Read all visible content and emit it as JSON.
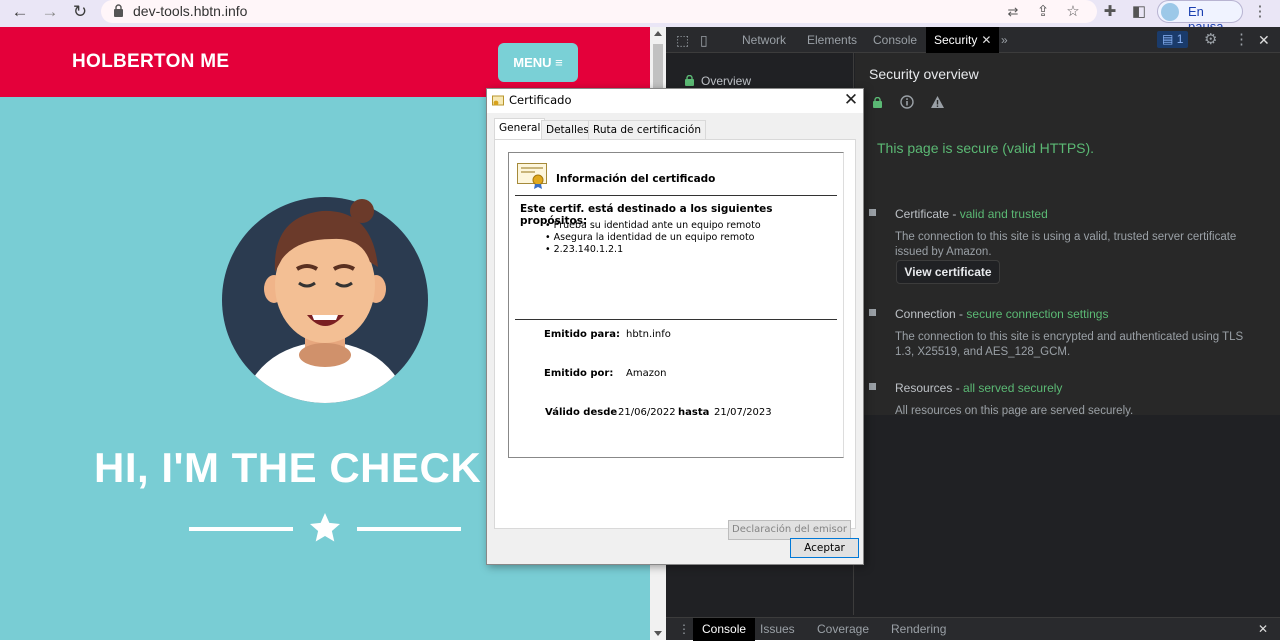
{
  "browser": {
    "url": "dev-tools.hbtn.info",
    "profile_label": "En pausa",
    "icons": [
      "back-icon",
      "forward-icon",
      "reload-icon",
      "lock-icon",
      "translate-icon",
      "share-icon",
      "star-icon",
      "extensions-icon",
      "sidepanel-icon",
      "more-icon"
    ]
  },
  "site": {
    "brand": "HOLBERTON ME",
    "menu_label": "MENU ≡",
    "hero_title": "HI, I'M THE CHECK",
    "colors": {
      "header": "#e4003a",
      "background": "#79cdd4"
    }
  },
  "devtools": {
    "tabs": [
      "Network",
      "Elements",
      "Console",
      "Security"
    ],
    "active_tab": "Security",
    "issues_count": "1",
    "sidebar": {
      "overview": "Overview"
    },
    "main": {
      "title": "Security overview",
      "secure_message": "This page is secure (valid HTTPS).",
      "certificate": {
        "head": "Certificate",
        "status": "valid and trusted",
        "desc": "The connection to this site is using a valid, trusted server certificate issued by Amazon.",
        "button": "View certificate"
      },
      "connection": {
        "head": "Connection",
        "status": "secure connection settings",
        "desc": "The connection to this site is encrypted and authenticated using TLS 1.3, X25519, and AES_128_GCM."
      },
      "resources": {
        "head": "Resources",
        "status": "all served securely",
        "desc": "All resources on this page are served securely."
      }
    },
    "bottom_tabs": [
      "Console",
      "Issues",
      "Coverage",
      "Rendering"
    ],
    "colors": {
      "secure_green": "#5bb974",
      "background": "#202124"
    }
  },
  "cert_dialog": {
    "title": "Certificado",
    "tabs": [
      "General",
      "Detalles",
      "Ruta de certificación"
    ],
    "info_title": "Información del certificado",
    "purpose_title": "Este certif. está destinado a los siguientes propósitos:",
    "purposes": [
      "• Prueba su identidad ante un equipo remoto",
      "• Asegura la identidad de un equipo remoto",
      "• 2.23.140.1.2.1"
    ],
    "issued_to_label": "Emitido para:",
    "issued_to": "hbtn.info",
    "issued_by_label": "Emitido por:",
    "issued_by": "Amazon",
    "valid_from_label": "Válido desde",
    "valid_from": "21/06/2022",
    "valid_to_label": "hasta",
    "valid_to": "21/07/2023",
    "issuer_statement_button": "Declaración del emisor",
    "ok_button": "Aceptar"
  }
}
